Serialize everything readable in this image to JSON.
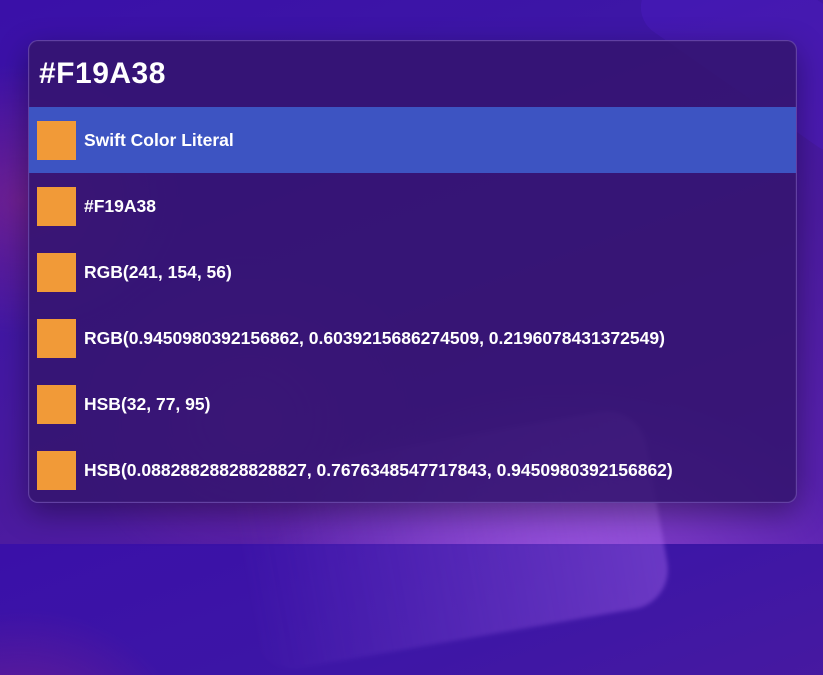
{
  "search": {
    "value": "#F19A38"
  },
  "swatch_color": "#F19A38",
  "selection_color": "#3D54C2",
  "results": [
    {
      "label": "Swift Color Literal",
      "selected": true
    },
    {
      "label": "#F19A38",
      "selected": false
    },
    {
      "label": "RGB(241, 154, 56)",
      "selected": false
    },
    {
      "label": "RGB(0.9450980392156862, 0.6039215686274509, 0.2196078431372549)",
      "selected": false
    },
    {
      "label": "HSB(32, 77, 95)",
      "selected": false
    },
    {
      "label": "HSB(0.08828828828828827, 0.7676348547717843, 0.9450980392156862)",
      "selected": false
    }
  ]
}
